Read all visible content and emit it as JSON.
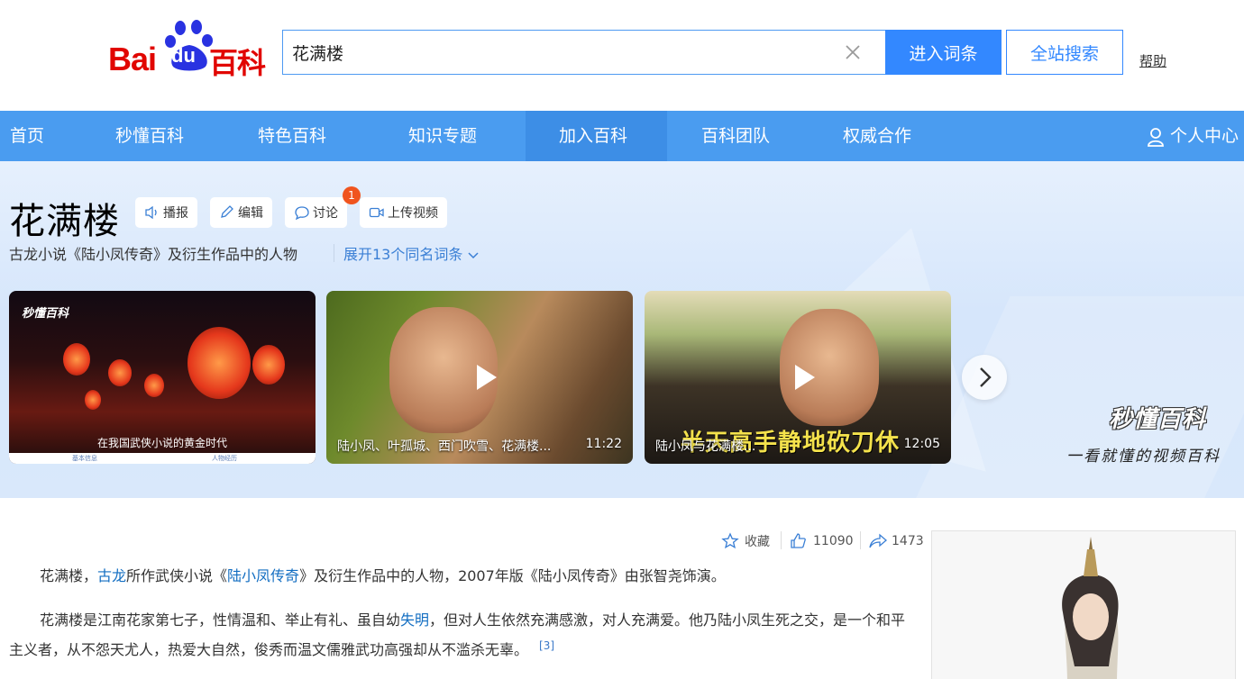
{
  "header": {
    "logo_bai": "Bai",
    "logo_du": "du",
    "logo_baike": "百科",
    "search_value": "花满楼",
    "enter_button": "进入词条",
    "site_search_button": "全站搜索",
    "help": "帮助"
  },
  "nav": {
    "items": [
      "首页",
      "秒懂百科",
      "特色百科",
      "知识专题",
      "加入百科",
      "百科团队",
      "权威合作"
    ],
    "user_center": "个人中心"
  },
  "entry": {
    "title": "花满楼",
    "tools": [
      "播报",
      "编辑",
      "讨论",
      "上传视频"
    ],
    "discuss_badge": "1",
    "subtitle": "古龙小说《陆小凤传奇》及衍生作品中的人物",
    "expand": "展开13个同名词条"
  },
  "videos": [
    {
      "caption": "在我国武侠小说的黄金时代",
      "logo": "秒懂百科",
      "foot_left": "基本信息",
      "foot_right": "人物经历"
    },
    {
      "title": "陆小凤、叶孤城、西门吹雪、花满楼...",
      "duration": "11:22"
    },
    {
      "title": "陆小凤与花满楼...",
      "duration": "12:05",
      "subtitle_overlay": "半天高手静地砍刀休"
    }
  ],
  "brand": {
    "mdong_logo": "秒懂百科",
    "slogan": "一看就懂的视频百科"
  },
  "stats": {
    "favorite": "收藏",
    "likes": "11090",
    "shares": "1473"
  },
  "content": {
    "p1_before": "花满楼，",
    "p1_link1": "古龙",
    "p1_mid": "所作武侠小说《",
    "p1_link2": "陆小凤传奇",
    "p1_after": "》及衍生作品中的人物，2007年版《陆小凤传奇》由张智尧饰演。",
    "p2_before": "花满楼是江南花家第七子，性情温和、举止有礼、虽自幼",
    "p2_link": "失明",
    "p2_after": "，但对人生依然充满感激，对人充满爱。他乃陆小凤生死之交，是一个和平主义者，从不怨天尤人，热爱大自然，俊秀而温文儒雅武功高强却从不滥杀无辜。",
    "p2_ref": "[3]"
  },
  "colors": {
    "brand_red": "#e10601",
    "brand_blue": "#3388ff",
    "nav_blue": "#4a9cf0",
    "link_blue": "#136ec2",
    "badge_orange": "#f0541e"
  }
}
